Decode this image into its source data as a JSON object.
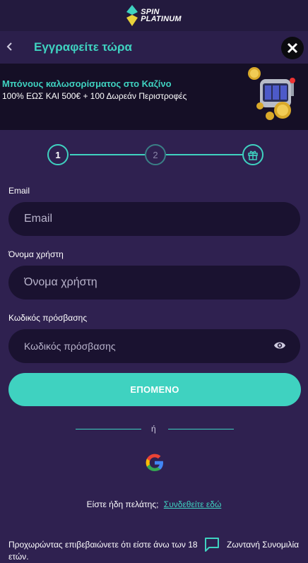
{
  "brand": {
    "line1": "SPIN",
    "line2": "PLATINUM"
  },
  "header": {
    "title": "Εγγραφείτε τώρα"
  },
  "promo": {
    "title": "Μπόνους καλωσορίσματος στο Καζίνο",
    "subtitle": "100% ΕΩΣ ΚΑΙ 500€ + 100 Δωρεάν Περιστροφές"
  },
  "steps": [
    {
      "label": "1",
      "state": "active"
    },
    {
      "label": "2",
      "state": "inactive"
    },
    {
      "icon": "gift-icon",
      "state": "final"
    }
  ],
  "form": {
    "email_label": "Email",
    "email_placeholder": "Email",
    "username_label": "Όνομα χρήστη",
    "username_placeholder": "Όνομα χρήστη",
    "password_label": "Κωδικός πρόσβασης",
    "password_placeholder": "Κωδικός πρόσβασης",
    "next_label": "ΕΠΟΜΕΝΟ"
  },
  "divider": {
    "text": "ή"
  },
  "existing": {
    "question": "Είστε ήδη πελάτης;",
    "link": "Συνδεθείτε εδώ"
  },
  "footer": {
    "age_note": "Προχωρώντας επιβεβαιώνετε ότι είστε άνω των 18 ετών.",
    "chat_label": "Ζωντανή Συνομιλία"
  },
  "colors": {
    "accent": "#3fd2c0",
    "background": "#2f2150",
    "field": "#1a1230",
    "promo_bg": "#150f26"
  }
}
